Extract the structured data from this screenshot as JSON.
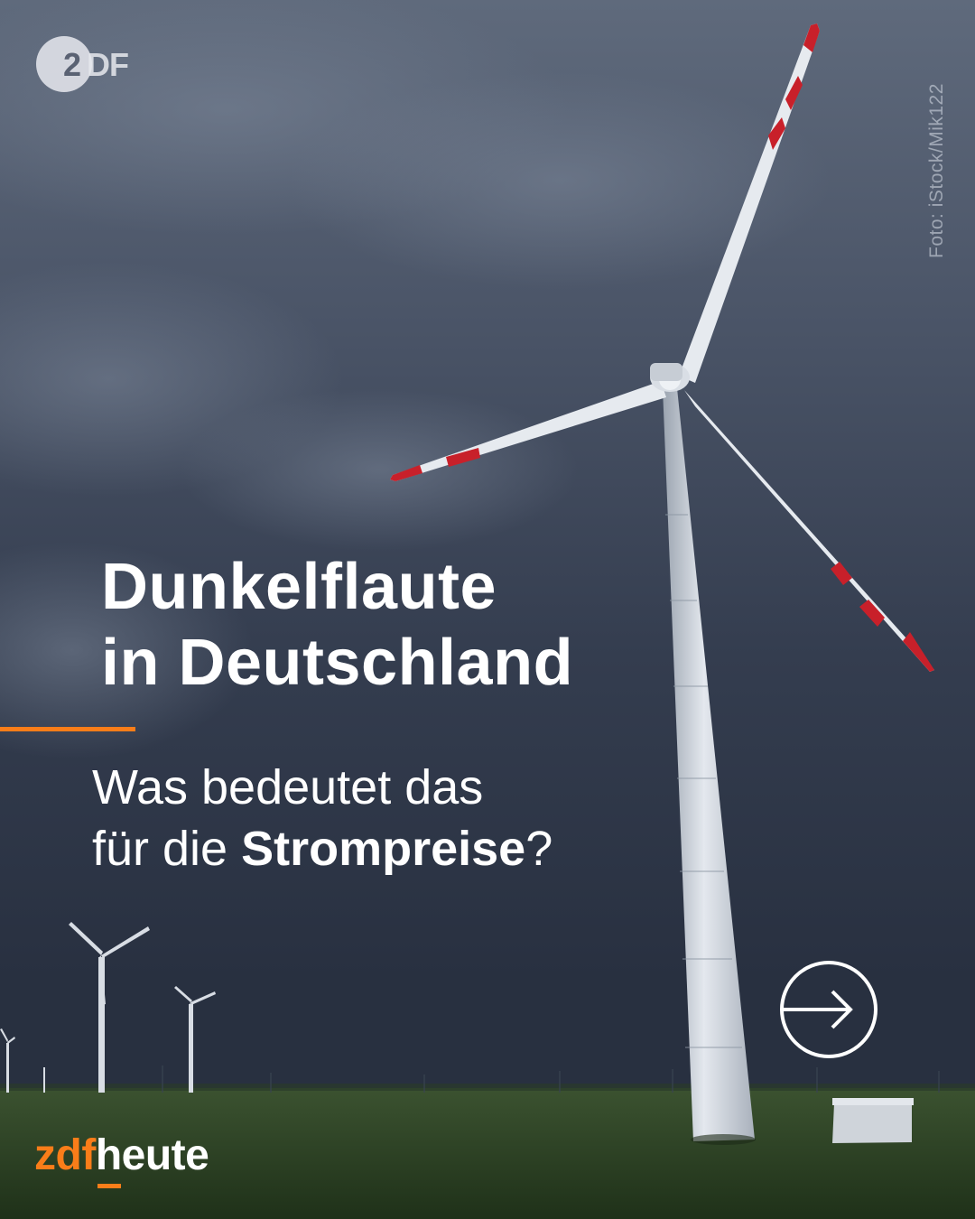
{
  "post": {
    "logo_text": "ZDF",
    "photo_credit": "Foto: iStock/Mik122",
    "headline_line1": "Dunkelflaute",
    "headline_line2": "in Deutschland",
    "subline_line1": "Was bedeutet das",
    "subline_line2_prefix": "für die ",
    "subline_line2_bold": "Strompreise",
    "subline_line2_suffix": "?",
    "brand_part1": "zdf",
    "brand_part2": "heute"
  },
  "icons": {
    "next": "arrow-right-circle-icon",
    "logo": "zdf-logo-icon"
  },
  "colors": {
    "accent": "#fa7d19",
    "text": "#ffffff",
    "sky": "#3c4658",
    "grass": "#2f4a24",
    "blade_tip": "#c8202a"
  }
}
